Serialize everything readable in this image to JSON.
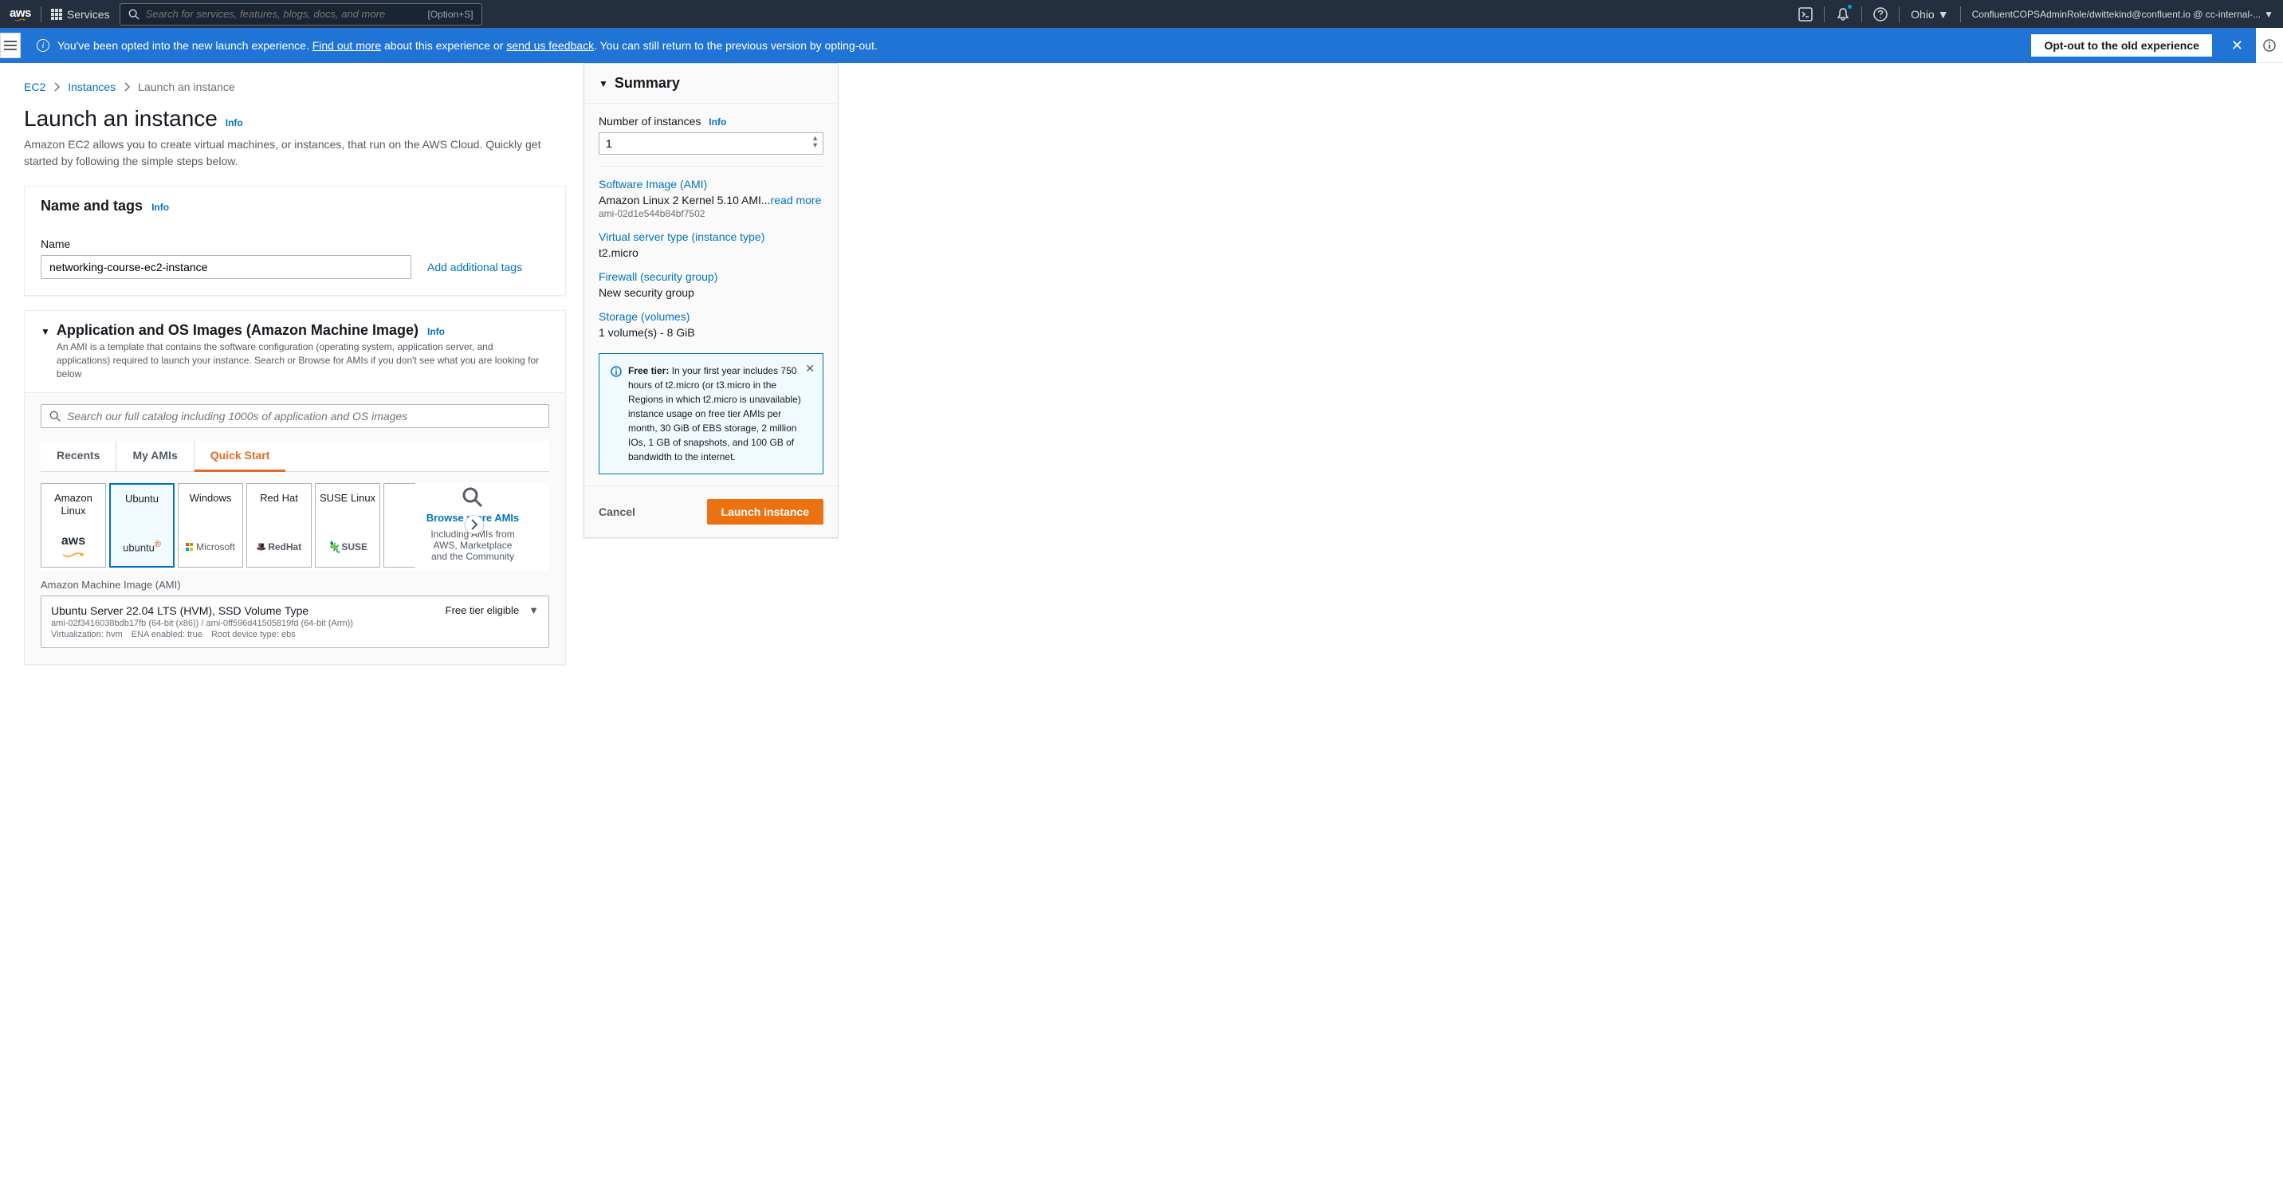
{
  "topnav": {
    "services_label": "Services",
    "search_placeholder": "Search for services, features, blogs, docs, and more",
    "search_kbd": "[Option+S]",
    "region": "Ohio",
    "account": "ConfluentCOPSAdminRole/dwittekind@confluent.io @ cc-internal-..."
  },
  "banner": {
    "text_pre": "You've been opted into the new launch experience. ",
    "link1": "Find out more",
    "text_mid": " about this experience or ",
    "link2": "send us feedback",
    "text_post": ". You can still return to the previous version by opting-out.",
    "optout_btn": "Opt-out to the old experience"
  },
  "breadcrumb": {
    "items": [
      "EC2",
      "Instances",
      "Launch an instance"
    ]
  },
  "page": {
    "title": "Launch an instance",
    "info": "Info",
    "desc": "Amazon EC2 allows you to create virtual machines, or instances, that run on the AWS Cloud. Quickly get started by following the simple steps below."
  },
  "name_tags": {
    "header": "Name and tags",
    "info": "Info",
    "name_label": "Name",
    "name_value": "networking-course-ec2-instance",
    "add_tags": "Add additional tags"
  },
  "ami_section": {
    "header": "Application and OS Images (Amazon Machine Image)",
    "info": "Info",
    "desc": "An AMI is a template that contains the software configuration (operating system, application server, and applications) required to launch your instance. Search or Browse for AMIs if you don't see what you are looking for below",
    "search_placeholder": "Search our full catalog including 1000s of application and OS images",
    "tabs": [
      "Recents",
      "My AMIs",
      "Quick Start"
    ],
    "tiles": [
      {
        "label": "Amazon Linux",
        "logo": "aws"
      },
      {
        "label": "Ubuntu",
        "logo": "ubuntu"
      },
      {
        "label": "Windows",
        "logo": "microsoft"
      },
      {
        "label": "Red Hat",
        "logo": "redhat"
      },
      {
        "label": "SUSE Linux",
        "logo": "suse"
      }
    ],
    "browse_more_link": "Browse more AMIs",
    "browse_more_sub": "Including AMIs from AWS, Marketplace and the Community",
    "ami_label": "Amazon Machine Image (AMI)",
    "selected_ami": {
      "title": "Ubuntu Server 22.04 LTS (HVM), SSD Volume Type",
      "meta1": "ami-02f3416038bdb17fb (64-bit (x86)) / ami-0ff596d41505819fd (64-bit (Arm))",
      "meta2": "Virtualization: hvm ENA enabled: true Root device type: ebs",
      "badge": "Free tier eligible"
    }
  },
  "summary": {
    "header": "Summary",
    "num_instances_label": "Number of instances",
    "num_instances_info": "Info",
    "num_instances_value": "1",
    "ami_label": "Software Image (AMI)",
    "ami_value": "Amazon Linux 2 Kernel 5.10 AMI...",
    "ami_readmore": "read more",
    "ami_id": "ami-02d1e544b84bf7502",
    "type_label": "Virtual server type (instance type)",
    "type_value": "t2.micro",
    "firewall_label": "Firewall (security group)",
    "firewall_value": "New security group",
    "storage_label": "Storage (volumes)",
    "storage_value": "1 volume(s) - 8 GiB",
    "free_tier_bold": "Free tier:",
    "free_tier_text": "In your first year includes 750 hours of t2.micro (or t3.micro in the Regions in which t2.micro is unavailable) instance usage on free tier AMIs per month, 30 GiB of EBS storage, 2 million IOs, 1 GB of snapshots, and 100 GB of bandwidth to the internet.",
    "cancel": "Cancel",
    "launch": "Launch instance"
  }
}
